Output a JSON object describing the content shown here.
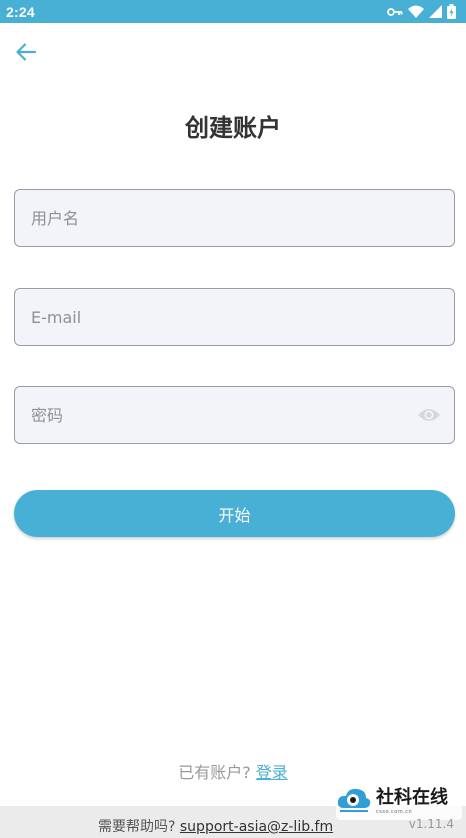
{
  "status_bar": {
    "time": "2:24",
    "icons": [
      "key-icon",
      "wifi-icon",
      "signal-icon",
      "battery-icon"
    ]
  },
  "page": {
    "title": "创建账户"
  },
  "form": {
    "username_placeholder": "用户名",
    "email_placeholder": "E-mail",
    "password_placeholder": "密码",
    "submit_label": "开始"
  },
  "login": {
    "prompt": "已有账户?",
    "link_label": "登录"
  },
  "footer": {
    "help_prompt": "需要帮助吗?",
    "help_email": "support-asia@z-lib.fm",
    "version": "v1.11.4"
  },
  "watermark": {
    "text": "社科在线",
    "sub": "csso.com.cn"
  },
  "colors": {
    "accent": "#48b0d4",
    "field_bg": "#f3f4f9",
    "field_border": "#9a9ca4",
    "footer_bg": "#ebebeb"
  }
}
